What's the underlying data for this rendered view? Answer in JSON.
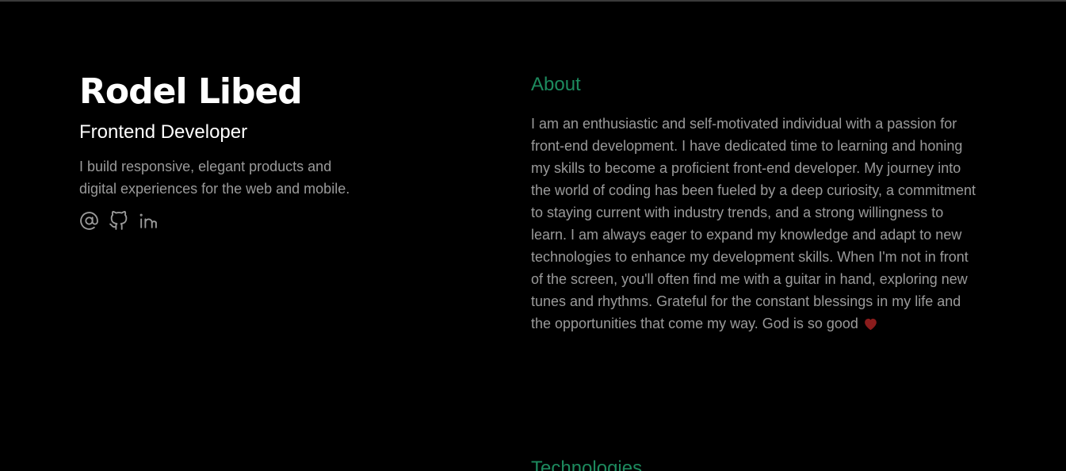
{
  "profile": {
    "name": "Rodel Libed",
    "role": "Frontend Developer",
    "tagline": "I build responsive, elegant products and digital experiences for the web and mobile."
  },
  "socials": [
    {
      "icon": "at-sign-icon"
    },
    {
      "icon": "github-icon"
    },
    {
      "icon": "linkedin-icon"
    }
  ],
  "about": {
    "title": "About",
    "text": "I am an enthusiastic and self-motivated individual with a passion for front-end development. I have dedicated time to learning and honing my skills to become a proficient front-end developer. My journey into the world of coding has been fueled by a deep curiosity, a commitment to staying current with industry trends, and a strong willingness to learn. I am always eager to expand my knowledge and adapt to new technologies to enhance my development skills. When I'm not in front of the screen, you'll often find me with a guitar in hand, exploring new tunes and rhythms. Grateful for the constant blessings in my life and the opportunities that come my way. God is so good",
    "emoji_icon": "heart-icon"
  },
  "technologies": {
    "title": "Technologies"
  },
  "colors": {
    "background": "#000000",
    "accent": "#1d8a5e",
    "text_muted": "#9a9a9a",
    "text_primary": "#ffffff",
    "heart": "#8b1c1c"
  }
}
